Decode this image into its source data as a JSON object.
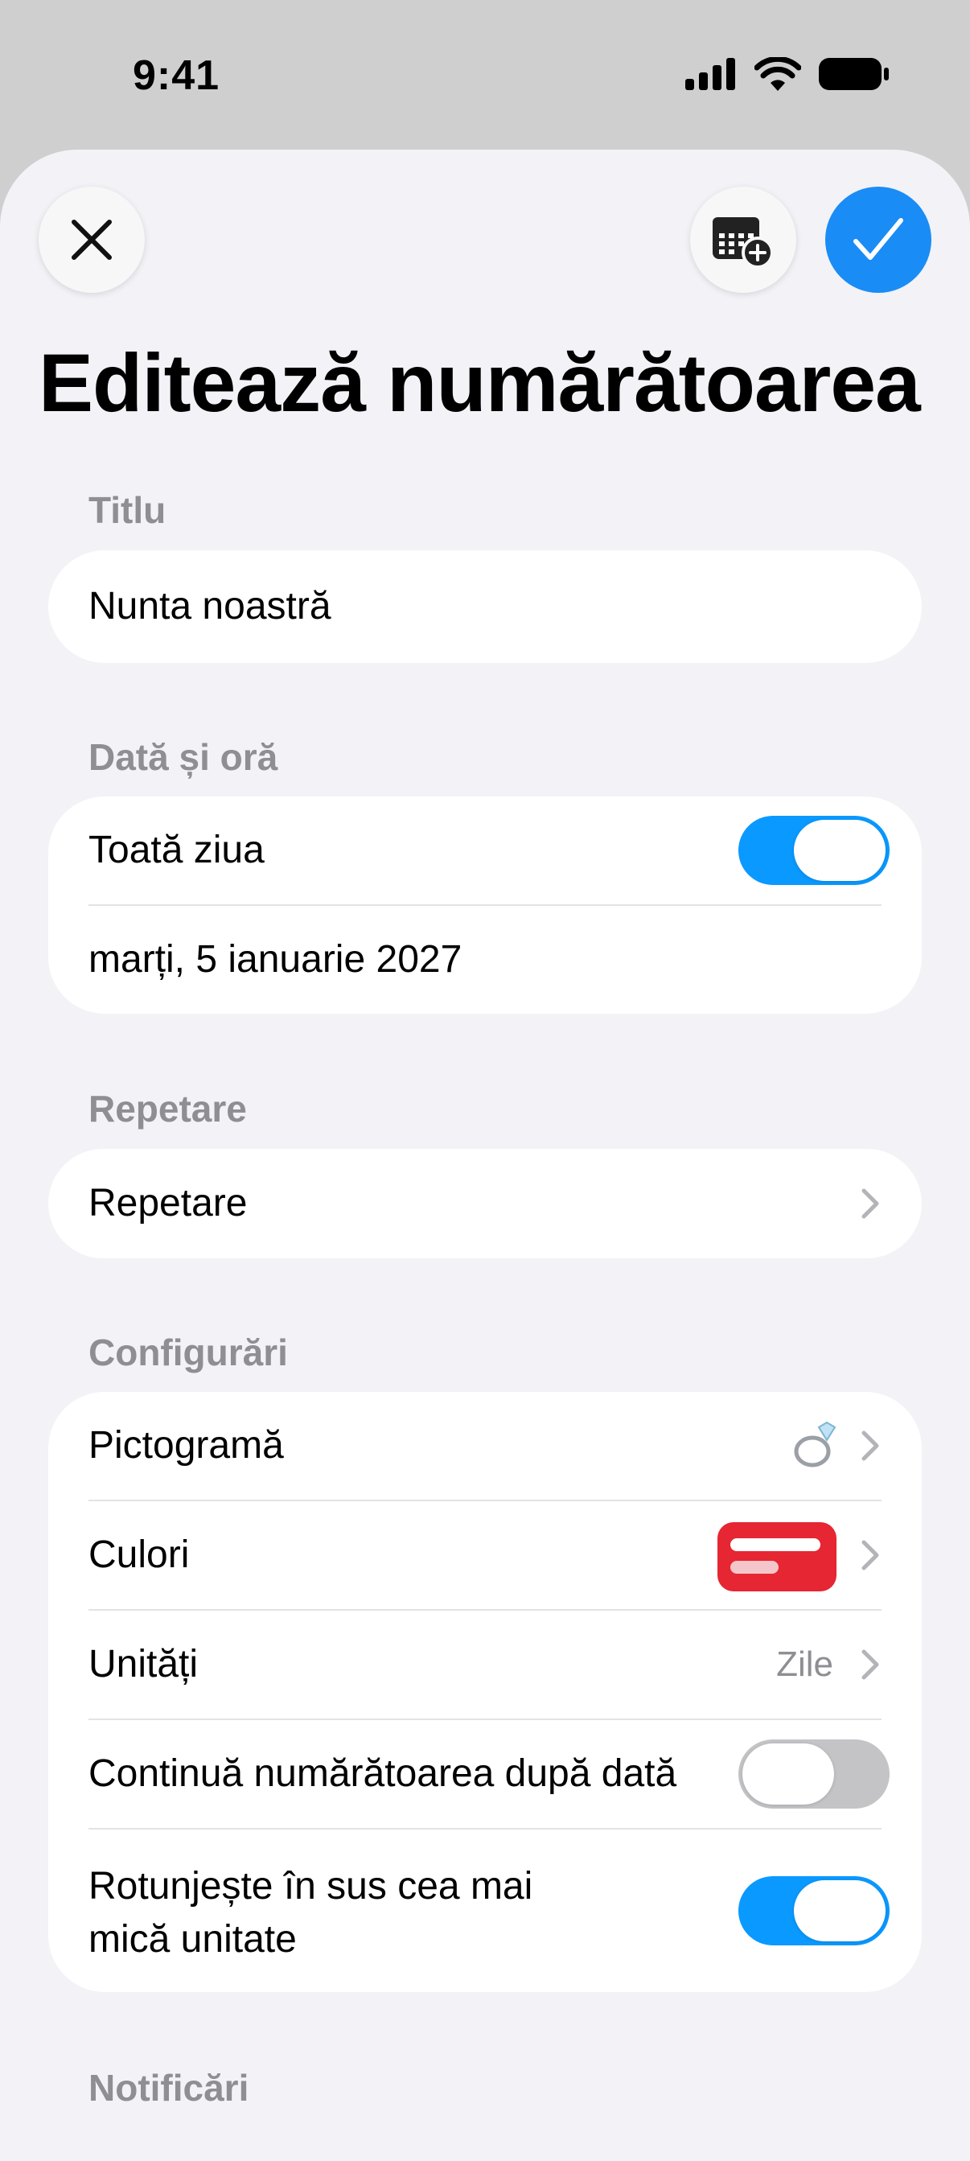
{
  "status_bar": {
    "time": "9:41"
  },
  "header": {
    "title": "Editează numărătoarea"
  },
  "sections": {
    "title": {
      "label": "Titlu",
      "value": "Nunta noastră"
    },
    "datetime": {
      "label": "Dată și oră",
      "all_day_label": "Toată ziua",
      "all_day_on": true,
      "date_value": "marți, 5 ianuarie 2027"
    },
    "repeat": {
      "label": "Repetare",
      "row_label": "Repetare"
    },
    "config": {
      "label": "Configurări",
      "icon_label": "Pictogramă",
      "icon_value": "ring-icon",
      "colors_label": "Culori",
      "color_value": "#e62632",
      "units_label": "Unități",
      "units_value": "Zile",
      "continue_label": "Continuă numărătoarea după dată",
      "continue_on": false,
      "round_label_line1": "Rotunjește în sus cea mai",
      "round_label_line2": "mică unitate",
      "round_on": true
    },
    "notifications": {
      "label": "Notificări"
    }
  },
  "colors": {
    "accent": "#1a8cf5",
    "toggle_on": "#0a99ff"
  }
}
